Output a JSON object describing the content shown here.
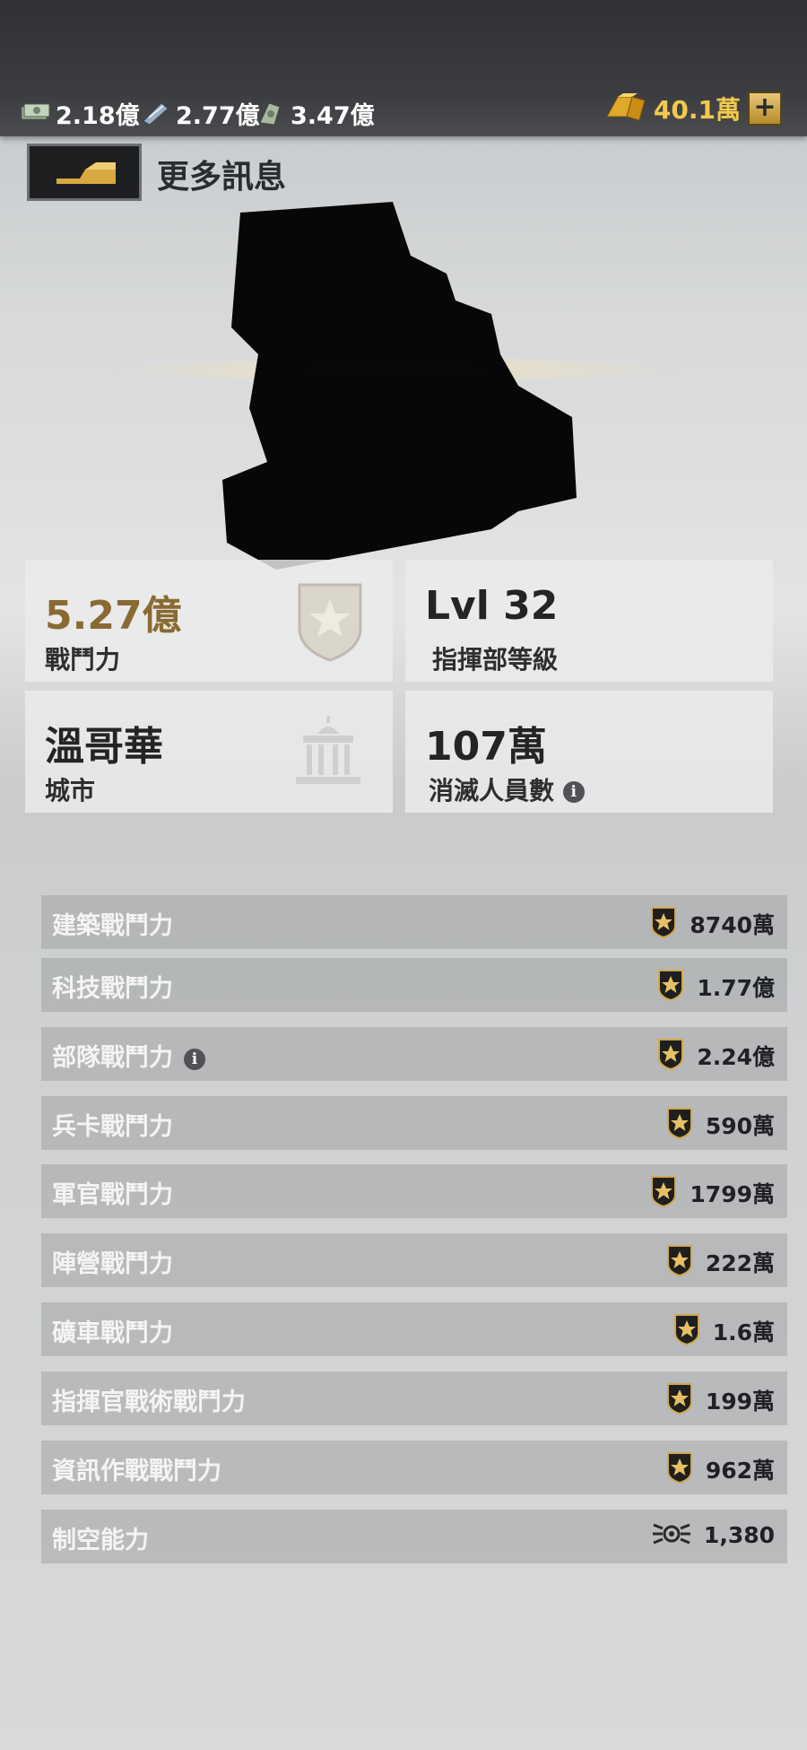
{
  "topbar": {
    "resources": [
      {
        "icon": "cash-icon",
        "value": "2.18億"
      },
      {
        "icon": "oil-icon",
        "value": "2.77億"
      },
      {
        "icon": "steel-icon",
        "value": "3.47億"
      }
    ],
    "gold": {
      "icon": "gold-bar-icon",
      "value": "40.1萬",
      "plus": "+"
    }
  },
  "header": {
    "title": "更多訊息"
  },
  "cards": [
    {
      "value": "5.27億",
      "label": "戰鬥力",
      "icon": "power-shield-icon"
    },
    {
      "value": "Lvl 32",
      "label": "指揮部等級"
    },
    {
      "value": "溫哥華",
      "label": "城市",
      "icon": "city-building-icon"
    },
    {
      "value": "107萬",
      "label": "消滅人員數",
      "info": "i"
    }
  ],
  "stats": [
    {
      "label": "建築戰鬥力",
      "value": "8740萬",
      "icon": "power-star-icon"
    },
    {
      "label": "科技戰鬥力",
      "value": "1.77億",
      "icon": "power-star-icon"
    },
    {
      "label": "部隊戰鬥力",
      "value": "2.24億",
      "icon": "power-star-icon",
      "info": "i"
    },
    {
      "label": "兵卡戰鬥力",
      "value": "590萬",
      "icon": "power-star-icon"
    },
    {
      "label": "軍官戰鬥力",
      "value": "1799萬",
      "icon": "power-star-icon"
    },
    {
      "label": "陣營戰鬥力",
      "value": "222萬",
      "icon": "power-star-icon"
    },
    {
      "label": "礦車戰鬥力",
      "value": "1.6萬",
      "icon": "power-star-icon"
    },
    {
      "label": "指揮官戰術戰鬥力",
      "value": "199萬",
      "icon": "power-star-icon"
    },
    {
      "label": "資訊作戰戰鬥力",
      "value": "962萬",
      "icon": "power-star-icon"
    },
    {
      "label": "制空能力",
      "value": "1,380",
      "icon": "wings-icon"
    }
  ],
  "colors": {
    "gold": "#f2c94c",
    "power_value": "#8a6a33"
  }
}
